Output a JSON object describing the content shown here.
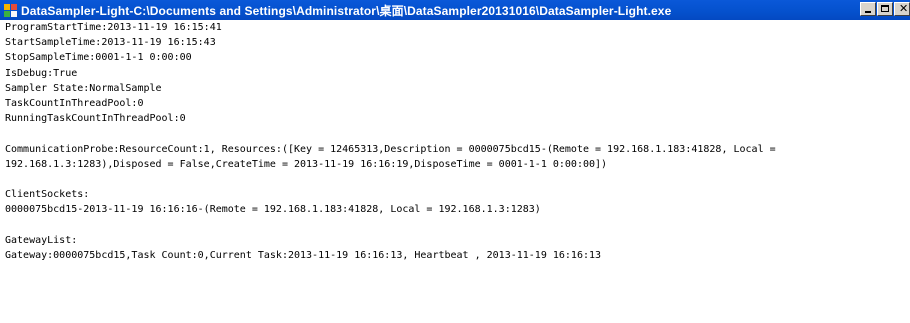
{
  "window": {
    "title": "DataSampler-Light-C:\\Documents and Settings\\Administrator\\桌面\\DataSampler20131016\\DataSampler-Light.exe",
    "titlebar_color": "#0552cf"
  },
  "icons": {
    "app": "app-icon",
    "minimize": "minimize-icon",
    "maximize": "maximize-icon",
    "close": "close-icon"
  },
  "lines": [
    "ProgramStartTime:2013-11-19 16:15:41",
    "StartSampleTime:2013-11-19 16:15:43",
    "StopSampleTime:0001-1-1 0:00:00",
    "IsDebug:True",
    "Sampler State:NormalSample",
    "TaskCountInThreadPool:0",
    "RunningTaskCountInThreadPool:0",
    "",
    "CommunicationProbe:ResourceCount:1, Resources:([Key = 12465313,Description = 0000075bcd15-(Remote = 192.168.1.183:41828, Local =",
    "192.168.1.3:1283),Disposed = False,CreateTime = 2013-11-19 16:16:19,DisposeTime = 0001-1-1 0:00:00])",
    "",
    "ClientSockets:",
    "0000075bcd15-2013-11-19 16:16:16-(Remote = 192.168.1.183:41828, Local = 192.168.1.3:1283)",
    "",
    "GatewayList:",
    "Gateway:0000075bcd15,Task Count:0,Current Task:2013-11-19 16:16:13, Heartbeat , 2013-11-19 16:16:13"
  ]
}
